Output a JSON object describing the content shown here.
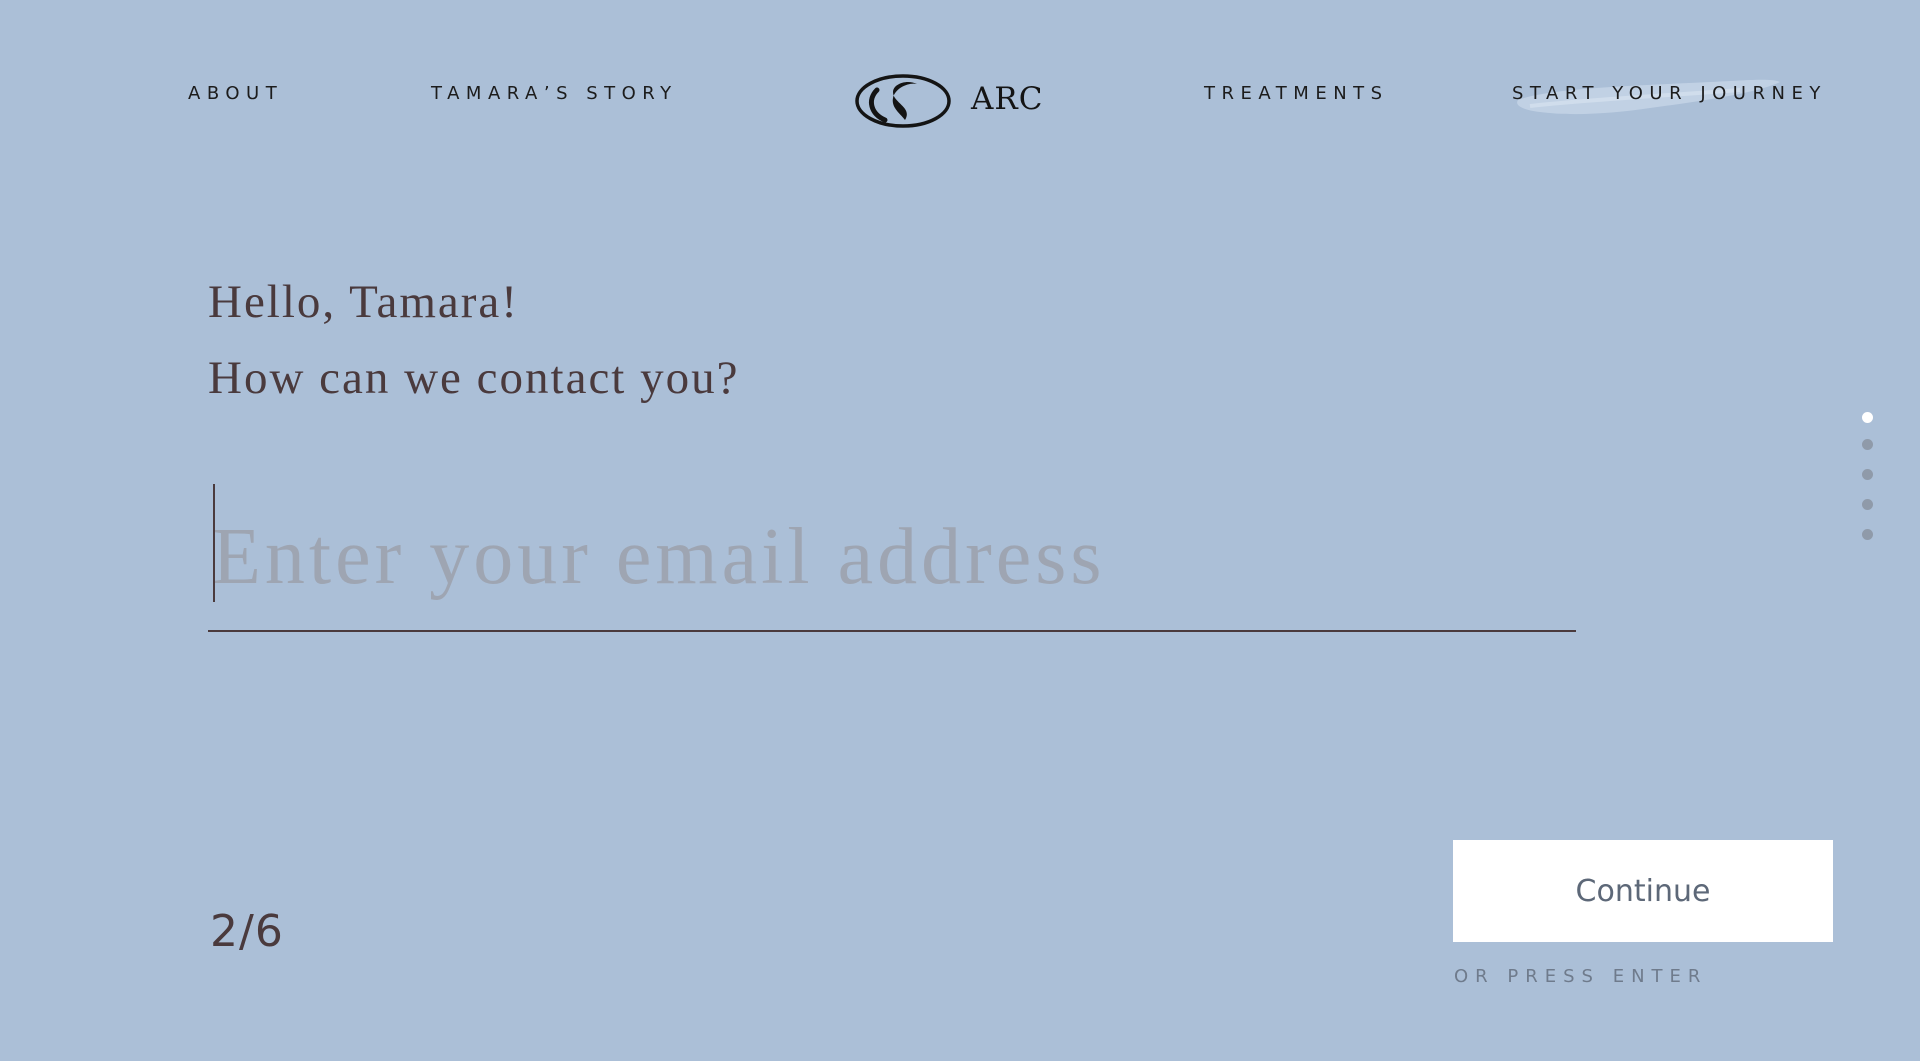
{
  "nav": {
    "about": "ABOUT",
    "story": "TAMARA’S STORY",
    "treatments": "TREATMENTS",
    "start": "START YOUR JOURNEY",
    "logo_text": "ARC"
  },
  "form": {
    "greeting": "Hello, Tamara!",
    "question": "How can we contact you?",
    "email_value": "",
    "email_placeholder": "Enter your email address",
    "progress": "2/6",
    "continue_label": "Continue",
    "hint": "OR PRESS ENTER"
  },
  "steps": {
    "total": 5,
    "active_index": 0
  },
  "colors": {
    "background": "#abbfd7",
    "text_dark": "#4a3a3d",
    "placeholder": "#9ea5b2",
    "button_bg": "#ffffff",
    "dot_active": "#ffffff",
    "dot_inactive": "#8f9aa9"
  }
}
